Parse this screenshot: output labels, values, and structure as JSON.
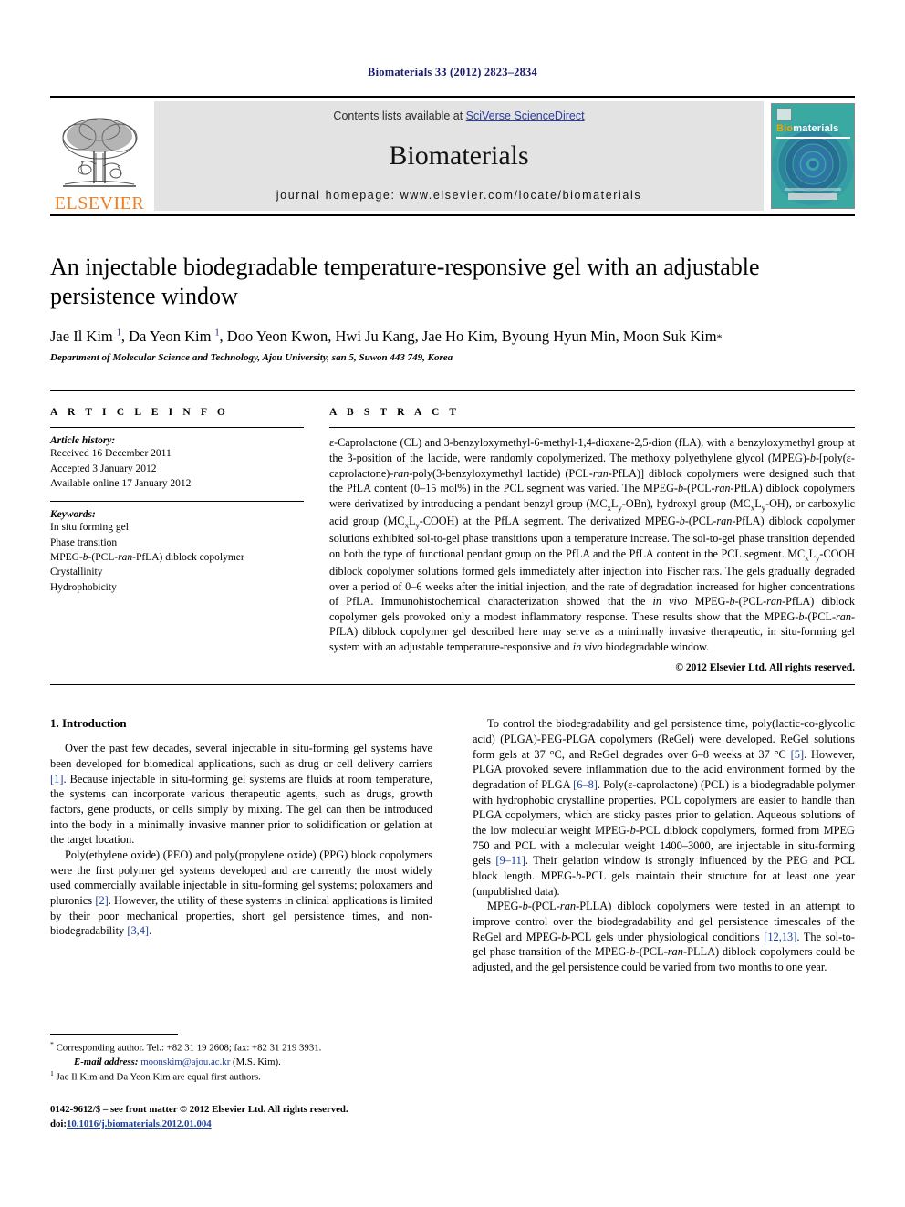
{
  "running_head": "Biomaterials 33 (2012) 2823–2834",
  "masthead": {
    "publisher_wordmark": "ELSEVIER",
    "contents_prefix": "Contents lists available at ",
    "contents_link": "SciVerse ScienceDirect",
    "journal_name": "Biomaterials",
    "homepage_line": "journal homepage: www.elsevier.com/locate/biomaterials",
    "cover": {
      "title_part1": "Bio",
      "title_part2": "materials",
      "background_color": "#38a8a0",
      "accent_color": "#f0a400"
    }
  },
  "article": {
    "title": "An injectable biodegradable temperature-responsive gel with an adjustable persistence window",
    "authors_html": "Jae Il Kim <sup>1</sup>, Da Yeon Kim <sup>1</sup>, Doo Yeon Kwon, Hwi Ju Kang, Jae Ho Kim, Byoung Hyun Min, Moon Suk Kim<span class=\"star\">*</span>",
    "affiliation": "Department of Molecular Science and Technology, Ajou University, san 5, Suwon 443 749, Korea"
  },
  "article_info": {
    "heading": "A R T I C L E   I N F O",
    "history_label": "Article history:",
    "history": [
      "Received 16 December 2011",
      "Accepted 3 January 2012",
      "Available online 17 January 2012"
    ],
    "keywords_label": "Keywords:",
    "keywords_html": [
      "In situ forming gel",
      "Phase transition",
      "MPEG-<i>b</i>-(PCL-<i>ran</i>-PfLA) diblock copolymer",
      "Crystallinity",
      "Hydrophobicity"
    ]
  },
  "abstract": {
    "heading": "A B S T R A C T",
    "body_html": "&epsilon;-Caprolactone (CL) and 3-benzyloxymethyl-6-methyl-1,4-dioxane-2,5-dion (fLA), with a benzyloxymethyl group at the 3-position of the lactide, were randomly copolymerized. The methoxy polyethylene glycol (MPEG)-<i>b</i>-[poly(&epsilon;-caprolactone)-<i>ran</i>-poly(3-benzyloxymethyl lactide) (PCL-<i>ran</i>-PfLA)] diblock copolymers were designed such that the PfLA content (0&ndash;15 mol%) in the PCL segment was varied. The MPEG-<i>b</i>-(PCL-<i>ran</i>-PfLA) diblock copolymers were derivatized by introducing a pendant benzyl group (MC<sub>x</sub>L<sub>y</sub>-OBn), hydroxyl group (MC<sub>x</sub>L<sub>y</sub>-OH), or carboxylic acid group (MC<sub>x</sub>L<sub>y</sub>-COOH) at the PfLA segment. The derivatized MPEG-<i>b</i>-(PCL-<i>ran</i>-PfLA) diblock copolymer solutions exhibited sol-to-gel phase transitions upon a temperature increase. The sol-to-gel phase transition depended on both the type of functional pendant group on the PfLA and the PfLA content in the PCL segment. MC<sub>x</sub>L<sub>y</sub>-COOH diblock copolymer solutions formed gels immediately after injection into Fischer rats. The gels gradually degraded over a period of 0&ndash;6 weeks after the initial injection, and the rate of degradation increased for higher concentrations of PfLA. Immunohistochemical characterization showed that the <i>in vivo</i> MPEG-<i>b</i>-(PCL-<i>ran</i>-PfLA) diblock copolymer gels provoked only a modest inflammatory response. These results show that the MPEG-<i>b</i>-(PCL-<i>ran</i>-PfLA) diblock copolymer gel described here may serve as a minimally invasive therapeutic, in situ-forming gel system with an adjustable temperature-responsive and <i>in vivo</i> biodegradable window.",
    "copyright": "© 2012 Elsevier Ltd. All rights reserved."
  },
  "introduction": {
    "section_title": "1.  Introduction",
    "left_paragraphs_html": [
      "Over the past few decades, several injectable in situ-forming gel systems have been developed for biomedical applications, such as drug or cell delivery carriers <span class=\"cit\">[1]</span>. Because injectable in situ-forming gel systems are fluids at room temperature, the systems can incorporate various therapeutic agents, such as drugs, growth factors, gene products, or cells simply by mixing. The gel can then be introduced into the body in a minimally invasive manner prior to solidification or gelation at the target location.",
      "Poly(ethylene oxide) (PEO) and poly(propylene oxide) (PPG) block copolymers were the first polymer gel systems developed and are currently the most widely used commercially available injectable in situ-forming gel systems; poloxamers and pluronics <span class=\"cit\">[2]</span>. However, the utility of these systems in clinical applications is limited by their poor mechanical properties, short gel persistence times, and non-biodegradability <span class=\"cit\">[3,4]</span>."
    ],
    "right_paragraphs_html": [
      "To control the biodegradability and gel persistence time, poly(lactic-co-glycolic acid) (PLGA)-PEG-PLGA copolymers (ReGel) were developed. ReGel solutions form gels at 37 &deg;C, and ReGel degrades over 6&ndash;8 weeks at 37 &deg;C <span class=\"cit\">[5]</span>. However, PLGA provoked severe inflammation due to the acid environment formed by the degradation of PLGA <span class=\"cit\">[6&ndash;8]</span>. Poly(&epsilon;-caprolactone) (PCL) is a biodegradable polymer with hydrophobic crystalline properties. PCL copolymers are easier to handle than PLGA copolymers, which are sticky pastes prior to gelation. Aqueous solutions of the low molecular weight MPEG-<i>b</i>-PCL diblock copolymers, formed from MPEG 750 and PCL with a molecular weight 1400&ndash;3000, are injectable in situ-forming gels <span class=\"cit\">[9&ndash;11]</span>. Their gelation window is strongly influenced by the PEG and PCL block length. MPEG-<i>b</i>-PCL gels maintain their structure for at least one year (unpublished data).",
      "MPEG-<i>b</i>-(PCL-<i>ran</i>-PLLA) diblock copolymers were tested in an attempt to improve control over the biodegradability and gel persistence timescales of the ReGel and MPEG-<i>b</i>-PCL gels under physiological conditions <span class=\"cit\">[12,13]</span>. The sol-to-gel phase transition of the MPEG-<i>b</i>-(PCL-<i>ran</i>-PLLA) diblock copolymers could be adjusted, and the gel persistence could be varied from two months to one year."
    ]
  },
  "footnotes": {
    "corresponding_html": "<sup>*</sup> Corresponding author. Tel.: +82 31 19 2608; fax: +82 31 219 3931.",
    "email_html": "<em>E-mail address:</em> <span class=\"mono-link\">moonskim@ajou.ac.kr</span> (M.S. Kim).",
    "equal_authors_html": "<sup>1</sup> Jae Il Kim and Da Yeon Kim are equal first authors."
  },
  "page_footer": {
    "issn_line": "0142-9612/$ – see front matter © 2012 Elsevier Ltd. All rights reserved.",
    "doi_prefix": "doi:",
    "doi_link": "10.1016/j.biomaterials.2012.01.004"
  }
}
